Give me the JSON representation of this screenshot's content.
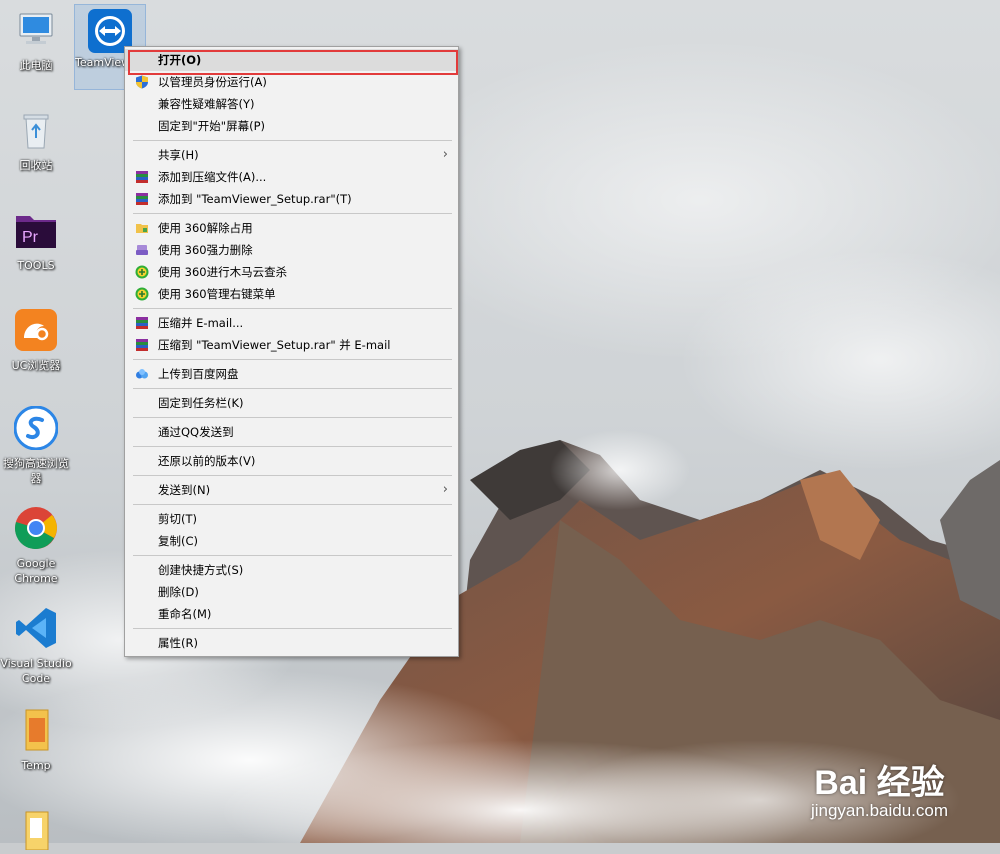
{
  "desktop": {
    "icons": [
      {
        "label": "此电脑"
      },
      {
        "label": "回收站"
      },
      {
        "label": "TOOLS"
      },
      {
        "label": "UC浏览器"
      },
      {
        "label": "搜狗高速浏览器"
      },
      {
        "label": "Google Chrome"
      },
      {
        "label": "Visual Studio Code"
      },
      {
        "label": "Temp"
      }
    ],
    "selected_icon": {
      "label": "TeamViewer_Setup"
    }
  },
  "context_menu": {
    "open": "打开(O)",
    "run_as_admin": "以管理员身份运行(A)",
    "troubleshoot": "兼容性疑难解答(Y)",
    "pin_start": "固定到\"开始\"屏幕(P)",
    "share": "共享(H)",
    "add_archive": "添加到压缩文件(A)...",
    "add_to_rar": "添加到 \"TeamViewer_Setup.rar\"(T)",
    "unlock_360": "使用 360解除占用",
    "force_delete_360": "使用 360强力删除",
    "trojan_scan_360": "使用 360进行木马云查杀",
    "menu_manage_360": "使用 360管理右键菜单",
    "compress_email": "压缩并 E-mail...",
    "compress_rar_email": "压缩到 \"TeamViewer_Setup.rar\" 并 E-mail",
    "baidu_upload": "上传到百度网盘",
    "pin_taskbar": "固定到任务栏(K)",
    "qq_send": "通过QQ发送到",
    "restore_version": "还原以前的版本(V)",
    "send_to": "发送到(N)",
    "cut": "剪切(T)",
    "copy": "复制(C)",
    "create_shortcut": "创建快捷方式(S)",
    "delete": "删除(D)",
    "rename": "重命名(M)",
    "properties": "属性(R)"
  },
  "watermark": {
    "main": "Bai 经验",
    "url": "jingyan.baidu.com"
  },
  "colors": {
    "highlight_border": "#e23b3b",
    "menu_bg": "#f2f2f2",
    "teamviewer_blue": "#0e6fcf"
  }
}
